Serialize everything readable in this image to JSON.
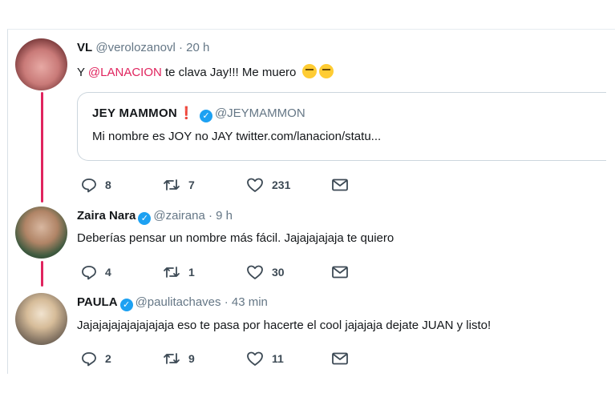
{
  "tweets": [
    {
      "name": "VL",
      "handle": "@verolozanovl",
      "time": "· 20 h",
      "text_before": "Y ",
      "mention": "@LANACION",
      "text_after": " te clava Jay!!! Me muero",
      "replies": "8",
      "retweets": "7",
      "likes": "231",
      "quote": {
        "name": "JEY MAMMON",
        "exclamation": "❗",
        "handle": "@JEYMAMMON",
        "text": "Mi nombre es JOY no JAY twitter.com/lanacion/statu..."
      }
    },
    {
      "name": "Zaira Nara",
      "handle": "@zairana",
      "time": "· 9 h",
      "text": "Deberías pensar un nombre más fácil. Jajajajajaja te quiero",
      "replies": "4",
      "retweets": "1",
      "likes": "30"
    },
    {
      "name": "PAULA",
      "handle": "@paulitachaves",
      "time": "· 43 min",
      "text": "Jajajajajajajajajaja eso te pasa por hacerte el cool jajajaja dejate JUAN y listo!",
      "replies": "2",
      "retweets": "9",
      "likes": "11"
    }
  ],
  "icons": [
    "reply-icon",
    "retweet-icon",
    "like-icon",
    "direct-message-icon",
    "verified-badge-icon",
    "emoji-icon"
  ],
  "colors": {
    "mention": "#e0245e",
    "thread_line": "#e0245e",
    "verified": "#1da1f2",
    "secondary_text": "#657786"
  }
}
